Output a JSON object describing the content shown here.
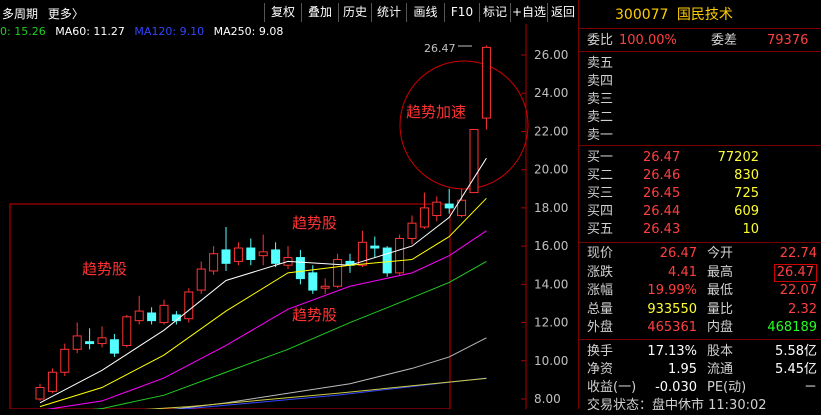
{
  "toolbar": {
    "period_label": "多周期",
    "more_label": "更多〉",
    "buttons": [
      "复权",
      "叠加",
      "历史",
      "统计",
      "画线",
      "F10",
      "标记",
      "+自选",
      "返回"
    ]
  },
  "ma_legend": {
    "ma_partial": "0: 15.26",
    "ma60": "MA60: 11.27",
    "ma120": "MA120: 9.10",
    "ma250": "MA250: 9.08"
  },
  "chart": {
    "y_ticks": [
      "26.00",
      "24.00",
      "22.00",
      "20.00",
      "18.00",
      "16.00",
      "14.00",
      "12.00",
      "10.00",
      "8.00"
    ],
    "y_tick_values": [
      26,
      24,
      22,
      20,
      18,
      16,
      14,
      12,
      10,
      8
    ],
    "peak_label": "26.47",
    "annotations": {
      "accel": "趋势加速",
      "trend_upper": "趋势股",
      "trend_left": "趋势股",
      "trend_lower": "趋势股"
    },
    "colors": {
      "up": "#ff3333",
      "down": "#54ffff",
      "ma5": "#ffffff",
      "ma10": "#ffff00",
      "ma20": "#ff00ff",
      "ma30": "#22cc22",
      "ma60": "#bbbbbb",
      "ma120": "#3344ff",
      "ma250": "#cccc44"
    }
  },
  "chart_data": {
    "type": "candlestick",
    "ylim": [
      8,
      27
    ],
    "candles": [
      {
        "o": 8.0,
        "c": 8.6,
        "h": 8.8,
        "l": 7.9
      },
      {
        "o": 8.4,
        "c": 9.4,
        "h": 9.6,
        "l": 8.3
      },
      {
        "o": 9.4,
        "c": 10.6,
        "h": 10.9,
        "l": 9.2
      },
      {
        "o": 10.6,
        "c": 11.3,
        "h": 12.0,
        "l": 10.4
      },
      {
        "o": 11.0,
        "c": 10.9,
        "h": 11.7,
        "l": 10.6
      },
      {
        "o": 10.9,
        "c": 11.2,
        "h": 11.8,
        "l": 10.7
      },
      {
        "o": 11.1,
        "c": 10.4,
        "h": 11.4,
        "l": 10.2
      },
      {
        "o": 10.8,
        "c": 12.3,
        "h": 12.4,
        "l": 10.7
      },
      {
        "o": 12.1,
        "c": 12.6,
        "h": 13.4,
        "l": 11.9
      },
      {
        "o": 12.5,
        "c": 12.1,
        "h": 12.8,
        "l": 11.9
      },
      {
        "o": 12.0,
        "c": 12.9,
        "h": 13.2,
        "l": 11.9
      },
      {
        "o": 12.4,
        "c": 12.1,
        "h": 12.6,
        "l": 11.9
      },
      {
        "o": 12.2,
        "c": 13.6,
        "h": 13.8,
        "l": 12.0
      },
      {
        "o": 13.7,
        "c": 14.8,
        "h": 15.2,
        "l": 13.5
      },
      {
        "o": 14.7,
        "c": 15.6,
        "h": 16.0,
        "l": 14.5
      },
      {
        "o": 15.8,
        "c": 15.1,
        "h": 17.0,
        "l": 14.7
      },
      {
        "o": 15.2,
        "c": 15.9,
        "h": 16.2,
        "l": 15.0
      },
      {
        "o": 15.9,
        "c": 15.3,
        "h": 16.4,
        "l": 15.0
      },
      {
        "o": 15.5,
        "c": 15.7,
        "h": 16.6,
        "l": 15.0
      },
      {
        "o": 15.8,
        "c": 15.1,
        "h": 16.2,
        "l": 14.9
      },
      {
        "o": 15.0,
        "c": 15.4,
        "h": 16.0,
        "l": 14.8
      },
      {
        "o": 15.4,
        "c": 14.3,
        "h": 15.8,
        "l": 14.0
      },
      {
        "o": 14.6,
        "c": 13.7,
        "h": 15.0,
        "l": 13.5
      },
      {
        "o": 13.8,
        "c": 13.9,
        "h": 14.3,
        "l": 13.5
      },
      {
        "o": 13.9,
        "c": 15.3,
        "h": 15.6,
        "l": 13.8
      },
      {
        "o": 15.2,
        "c": 15.0,
        "h": 15.6,
        "l": 14.6
      },
      {
        "o": 15.0,
        "c": 16.2,
        "h": 16.8,
        "l": 14.9
      },
      {
        "o": 16.0,
        "c": 15.9,
        "h": 16.5,
        "l": 15.4
      },
      {
        "o": 15.9,
        "c": 14.6,
        "h": 16.0,
        "l": 14.4
      },
      {
        "o": 14.6,
        "c": 16.4,
        "h": 16.6,
        "l": 14.5
      },
      {
        "o": 16.4,
        "c": 17.2,
        "h": 17.6,
        "l": 16.1
      },
      {
        "o": 17.0,
        "c": 18.0,
        "h": 18.8,
        "l": 16.9
      },
      {
        "o": 17.6,
        "c": 18.3,
        "h": 18.6,
        "l": 17.3
      },
      {
        "o": 18.2,
        "c": 18.0,
        "h": 19.0,
        "l": 17.7
      },
      {
        "o": 17.6,
        "c": 18.4,
        "h": 19.0,
        "l": 17.5
      },
      {
        "o": 18.8,
        "c": 22.1,
        "h": 22.1,
        "l": 18.8
      },
      {
        "o": 22.7,
        "c": 26.4,
        "h": 26.5,
        "l": 22.1
      }
    ],
    "ma_lines": {
      "ma5": [
        [
          0,
          7.8
        ],
        [
          5,
          9.5
        ],
        [
          10,
          11.6
        ],
        [
          15,
          14.2
        ],
        [
          20,
          15.2
        ],
        [
          25,
          15.0
        ],
        [
          30,
          16.0
        ],
        [
          33,
          17.5
        ],
        [
          36,
          20.6
        ]
      ],
      "ma10": [
        [
          0,
          7.6
        ],
        [
          5,
          8.6
        ],
        [
          10,
          10.3
        ],
        [
          15,
          12.6
        ],
        [
          20,
          14.6
        ],
        [
          25,
          15.0
        ],
        [
          30,
          15.3
        ],
        [
          33,
          16.5
        ],
        [
          36,
          18.5
        ]
      ],
      "ma20": [
        [
          0,
          7.4
        ],
        [
          5,
          7.9
        ],
        [
          10,
          9.1
        ],
        [
          15,
          10.8
        ],
        [
          20,
          12.7
        ],
        [
          25,
          13.9
        ],
        [
          30,
          14.6
        ],
        [
          33,
          15.5
        ],
        [
          36,
          16.8
        ]
      ],
      "ma30": [
        [
          0,
          7.2
        ],
        [
          5,
          7.5
        ],
        [
          10,
          8.2
        ],
        [
          15,
          9.4
        ],
        [
          20,
          10.6
        ],
        [
          25,
          12.0
        ],
        [
          30,
          13.3
        ],
        [
          33,
          14.1
        ],
        [
          36,
          15.2
        ]
      ],
      "ma60": [
        [
          0,
          7.1
        ],
        [
          5,
          7.2
        ],
        [
          10,
          7.4
        ],
        [
          15,
          7.8
        ],
        [
          20,
          8.3
        ],
        [
          25,
          8.8
        ],
        [
          30,
          9.6
        ],
        [
          33,
          10.2
        ],
        [
          36,
          11.2
        ]
      ],
      "ma120": [
        [
          0,
          7.0
        ],
        [
          12,
          7.5
        ],
        [
          24,
          8.2
        ],
        [
          36,
          9.1
        ]
      ],
      "ma250": [
        [
          0,
          7.1
        ],
        [
          12,
          7.6
        ],
        [
          24,
          8.3
        ],
        [
          36,
          9.08
        ]
      ]
    }
  },
  "quote": {
    "code": "300077",
    "name": "国民技术",
    "weibi_label": "委比",
    "weibi_value": "100.00%",
    "weicha_label": "委差",
    "weicha_value": "79376",
    "sell": [
      "卖五",
      "卖四",
      "卖三",
      "卖二",
      "卖一"
    ],
    "buy": [
      {
        "label": "买一",
        "price": "26.47",
        "vol": "77202"
      },
      {
        "label": "买二",
        "price": "26.46",
        "vol": "830"
      },
      {
        "label": "买三",
        "price": "26.45",
        "vol": "725"
      },
      {
        "label": "买四",
        "price": "26.44",
        "vol": "609"
      },
      {
        "label": "买五",
        "price": "26.43",
        "vol": "10"
      }
    ],
    "stats": [
      {
        "l1": "现价",
        "v1": "26.47",
        "c1": "red",
        "l2": "今开",
        "v2": "22.74",
        "c2": "red"
      },
      {
        "l1": "涨跌",
        "v1": "4.41",
        "c1": "red",
        "l2": "最高",
        "v2": "26.47",
        "c2": "red"
      },
      {
        "l1": "涨幅",
        "v1": "19.99%",
        "c1": "red",
        "l2": "最低",
        "v2": "22.07",
        "c2": "red"
      },
      {
        "l1": "总量",
        "v1": "933550",
        "c1": "yellow",
        "l2": "量比",
        "v2": "2.32",
        "c2": "red"
      },
      {
        "l1": "外盘",
        "v1": "465361",
        "c1": "red",
        "l2": "内盘",
        "v2": "468189",
        "c2": "green"
      }
    ],
    "stats2": [
      {
        "l1": "换手",
        "v1": "17.13%",
        "l2": "股本",
        "v2": "5.58亿"
      },
      {
        "l1": "净资",
        "v1": "1.95",
        "l2": "流通",
        "v2": "5.45亿"
      },
      {
        "l1": "收益(一)",
        "v1": "-0.030",
        "l2": "PE(动)",
        "v2": "－"
      }
    ],
    "bottom_partial": "交易状态：盘中休市 11:30:02"
  }
}
